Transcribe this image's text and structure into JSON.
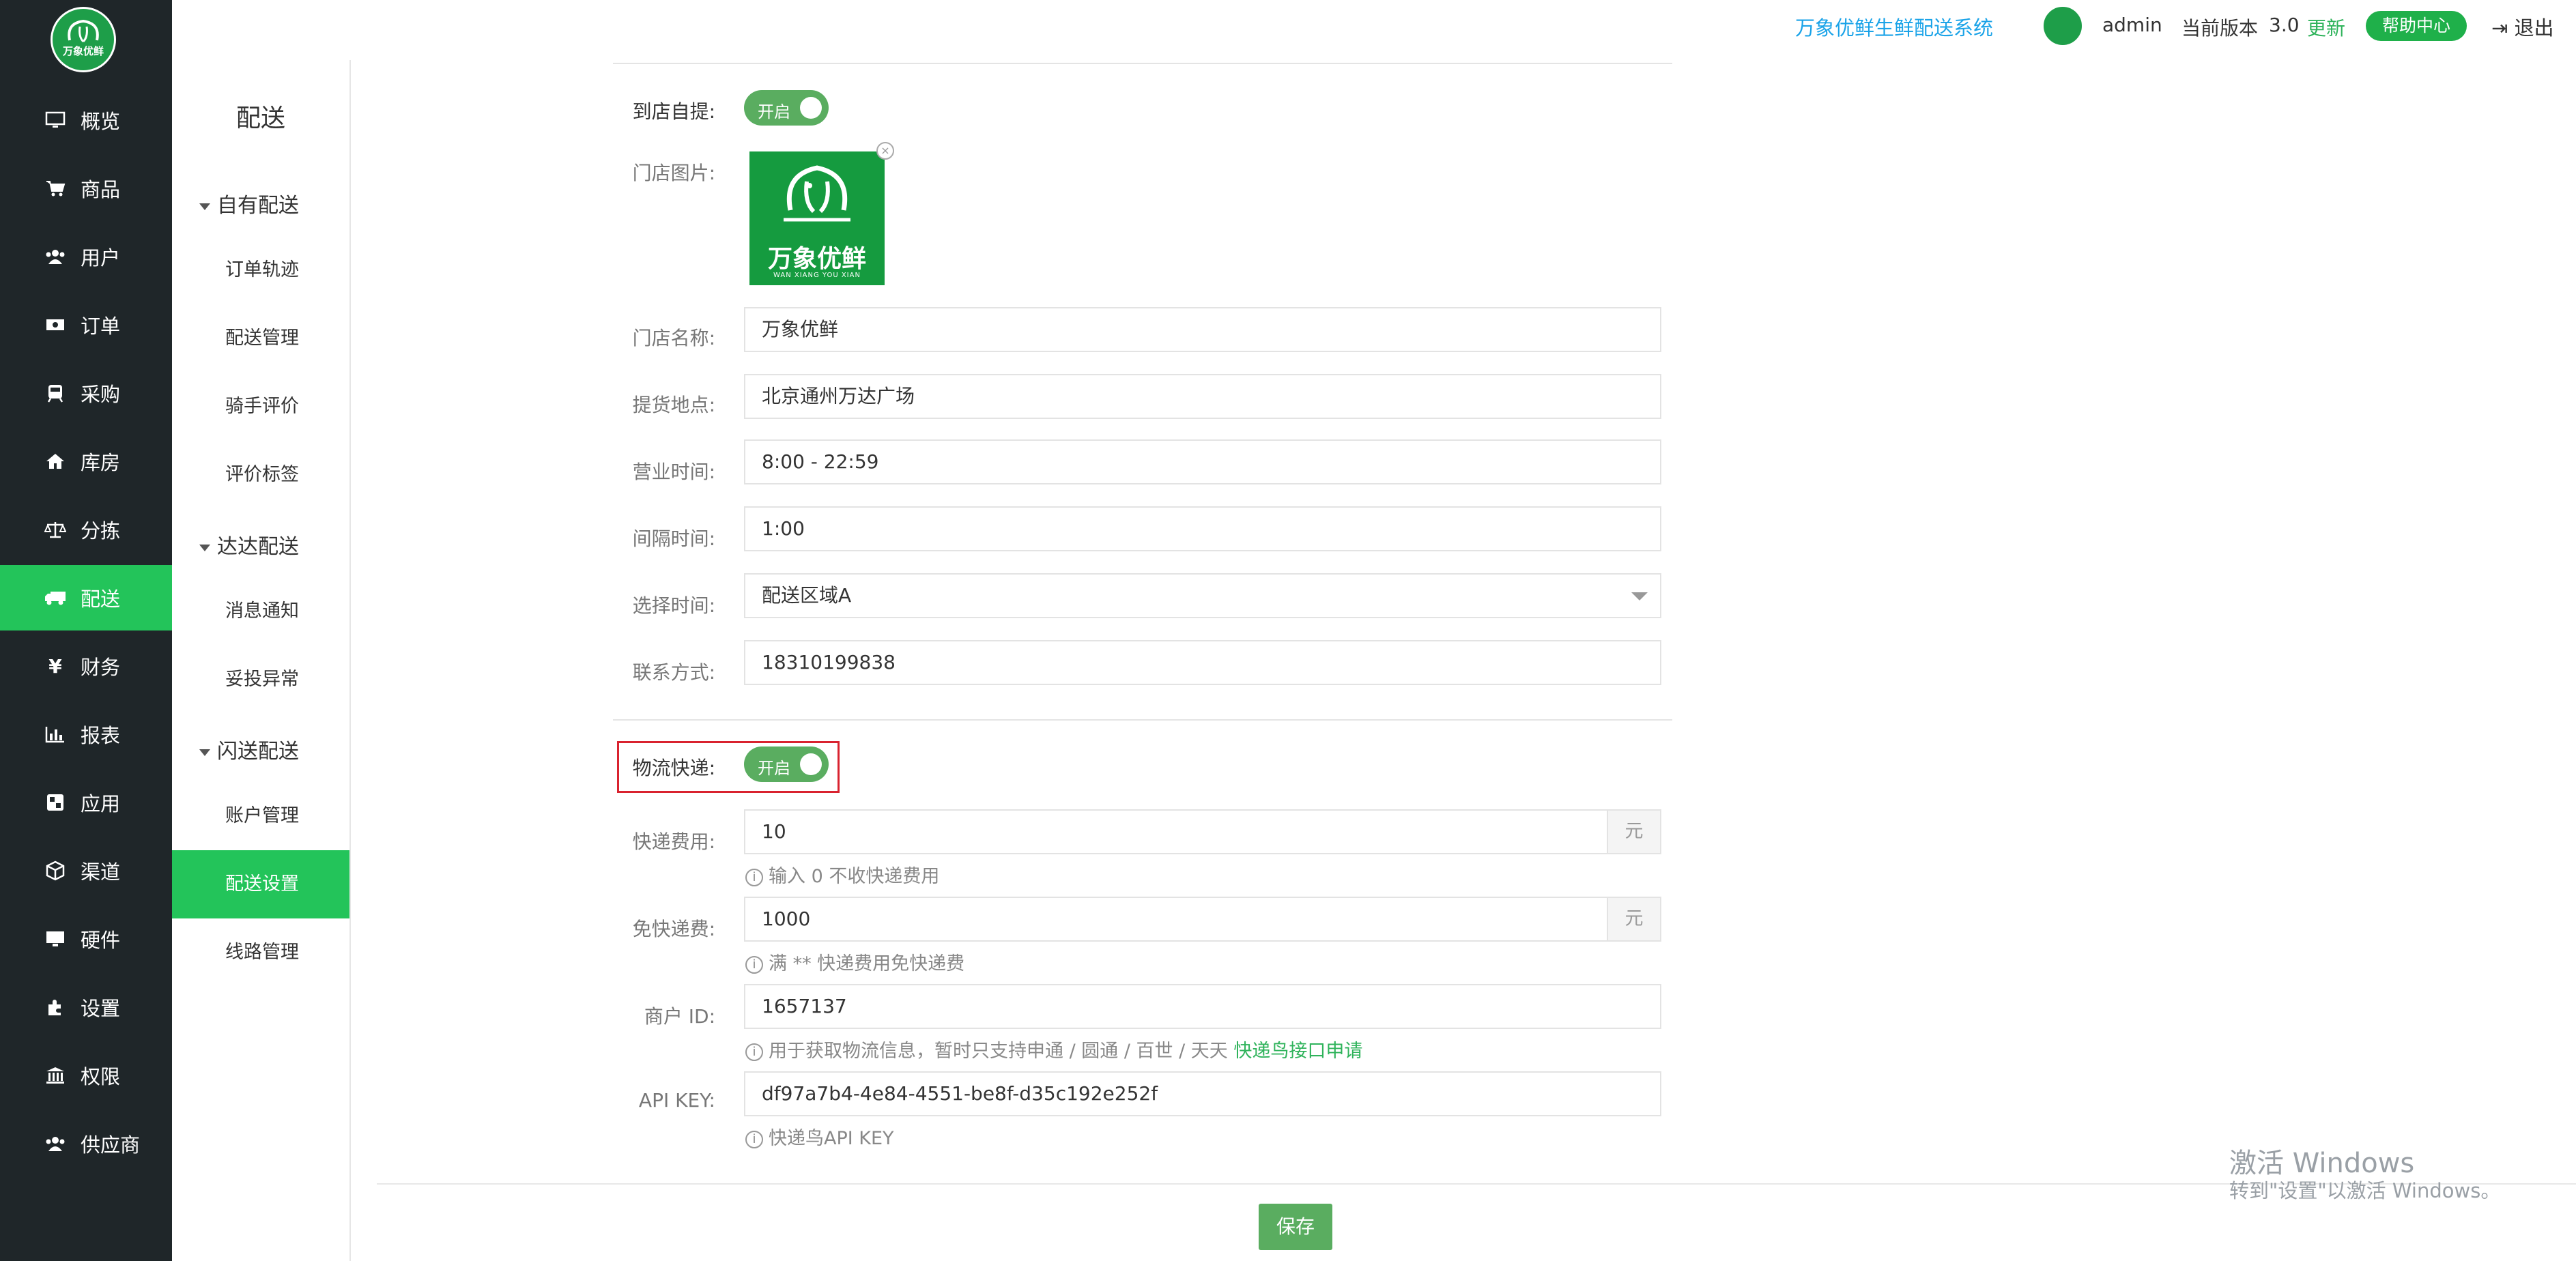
{
  "header": {
    "brand": "万象优鲜生鲜配送系统",
    "user": "admin",
    "version_label": "当前版本",
    "version": "3.0",
    "update": "更新",
    "help": "帮助中心",
    "logout": "退出"
  },
  "logo": {
    "text": "万象优鲜"
  },
  "sidebar": {
    "items": [
      {
        "label": "概览",
        "icon": "monitor-icon"
      },
      {
        "label": "商品",
        "icon": "cart-icon"
      },
      {
        "label": "用户",
        "icon": "users-icon"
      },
      {
        "label": "订单",
        "icon": "money-icon"
      },
      {
        "label": "采购",
        "icon": "train-icon"
      },
      {
        "label": "库房",
        "icon": "home-icon"
      },
      {
        "label": "分拣",
        "icon": "scale-icon"
      },
      {
        "label": "配送",
        "icon": "truck-icon",
        "active": true
      },
      {
        "label": "财务",
        "icon": "yen-icon"
      },
      {
        "label": "报表",
        "icon": "bar-chart-icon"
      },
      {
        "label": "应用",
        "icon": "apps-icon"
      },
      {
        "label": "渠道",
        "icon": "cube-icon"
      },
      {
        "label": "硬件",
        "icon": "desktop-icon"
      },
      {
        "label": "设置",
        "icon": "puzzle-icon"
      },
      {
        "label": "权限",
        "icon": "bank-icon"
      },
      {
        "label": "供应商",
        "icon": "group-icon"
      }
    ]
  },
  "submenu": {
    "title": "配送",
    "groups": [
      {
        "label": "自有配送",
        "items": [
          "订单轨迹",
          "配送管理",
          "骑手评价",
          "评价标签"
        ]
      },
      {
        "label": "达达配送",
        "items": [
          "消息通知",
          "妥投异常"
        ]
      },
      {
        "label": "闪送配送",
        "items": [
          "账户管理",
          "配送设置",
          "线路管理"
        ]
      }
    ],
    "active": "配送设置"
  },
  "form": {
    "pickup_label": "到店自提:",
    "pickup_toggle": "开启",
    "store_image_label": "门店图片:",
    "store_image_text": "万象优鲜",
    "store_image_sub": "WAN XIANG YOU XIAN",
    "store_name_label": "门店名称:",
    "store_name": "万象优鲜",
    "pickup_location_label": "提货地点:",
    "pickup_location": "北京通州万达广场",
    "business_hours_label": "营业时间:",
    "business_hours": "8:00 - 22:59",
    "interval_label": "间隔时间:",
    "interval": "1:00",
    "select_time_label": "选择时间:",
    "select_time": "配送区域A",
    "contact_label": "联系方式:",
    "contact": "18310199838",
    "express_label": "物流快递:",
    "express_toggle": "开启",
    "express_fee_label": "快递费用:",
    "express_fee": "10",
    "express_fee_unit": "元",
    "express_fee_hint": "输入 0 不收快递费用",
    "free_fee_label": "免快递费:",
    "free_fee": "1000",
    "free_fee_unit": "元",
    "free_fee_hint": "满 ** 快递费用免快递费",
    "merchant_id_label": "商户 ID:",
    "merchant_id": "1657137",
    "merchant_id_hint": "用于获取物流信息，暂时只支持申通 / 圆通 / 百世 / 天天",
    "merchant_id_link": "快递鸟接口申请",
    "api_key_label": "API KEY:",
    "api_key": "df97a7b4-4e84-4551-be8f-d35c192e252f",
    "api_key_hint": "快递鸟API KEY",
    "save": "保存"
  },
  "watermark": {
    "line1": "激活 Windows",
    "line2": "转到\"设置\"以激活 Windows。"
  },
  "colors": {
    "sidebar_bg": "#1f2629",
    "accent_green": "#23c45a",
    "toggle_green": "#5aad60",
    "brand_blue": "#1aa3e8",
    "highlight_red": "#d9232f"
  }
}
